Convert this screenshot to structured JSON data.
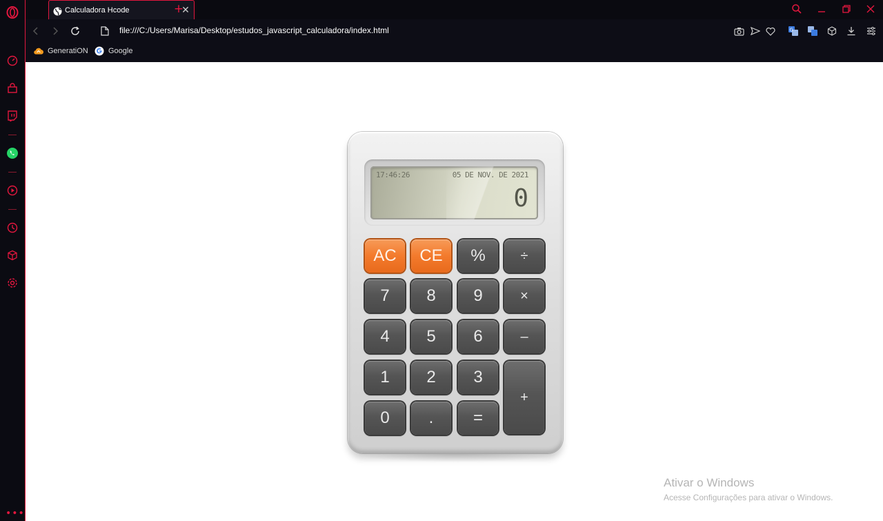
{
  "browser": {
    "tab_title": "Calculadora Hcode",
    "new_tab_label": "+",
    "url": "file:///C:/Users/Marisa/Desktop/estudos_javascript_calculadora/index.html",
    "bookmarks": [
      {
        "label": "GeneratiON",
        "icon": "cloud-icon"
      },
      {
        "label": "Google",
        "icon": "google-icon"
      }
    ],
    "accent_color": "#e3173e"
  },
  "calculator": {
    "time": "17:46:26",
    "date": "05 DE NOV. DE 2021",
    "display_value": "0",
    "keys": {
      "ac": "AC",
      "ce": "CE",
      "percent": "%",
      "divide": "÷",
      "seven": "7",
      "eight": "8",
      "nine": "9",
      "multiply": "×",
      "four": "4",
      "five": "5",
      "six": "6",
      "subtract": "–",
      "one": "1",
      "two": "2",
      "three": "3",
      "add": "+",
      "zero": "0",
      "dot": ".",
      "equals": "="
    },
    "accent_orange": "#f37a2c"
  },
  "watermark": {
    "title": "Ativar o Windows",
    "subtitle": "Acesse Configurações para ativar o Windows."
  }
}
